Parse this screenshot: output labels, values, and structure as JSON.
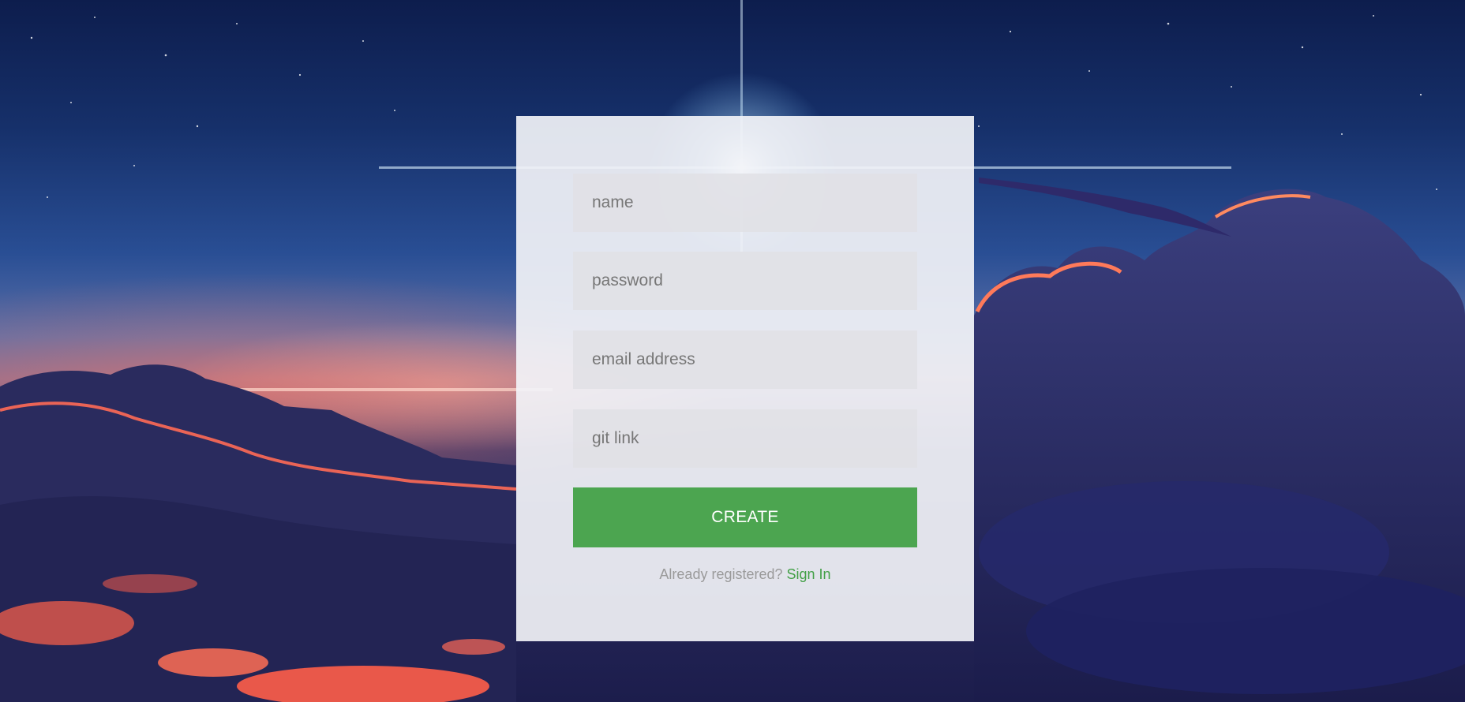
{
  "form": {
    "name_placeholder": "name",
    "password_placeholder": "password",
    "email_placeholder": "email address",
    "git_placeholder": "git link",
    "create_label": "CREATE",
    "already_registered_text": "Already registered?",
    "sign_in_label": "Sign In"
  },
  "colors": {
    "accent": "#4ca550",
    "link": "#43a047",
    "card": "#f2f3f7"
  }
}
